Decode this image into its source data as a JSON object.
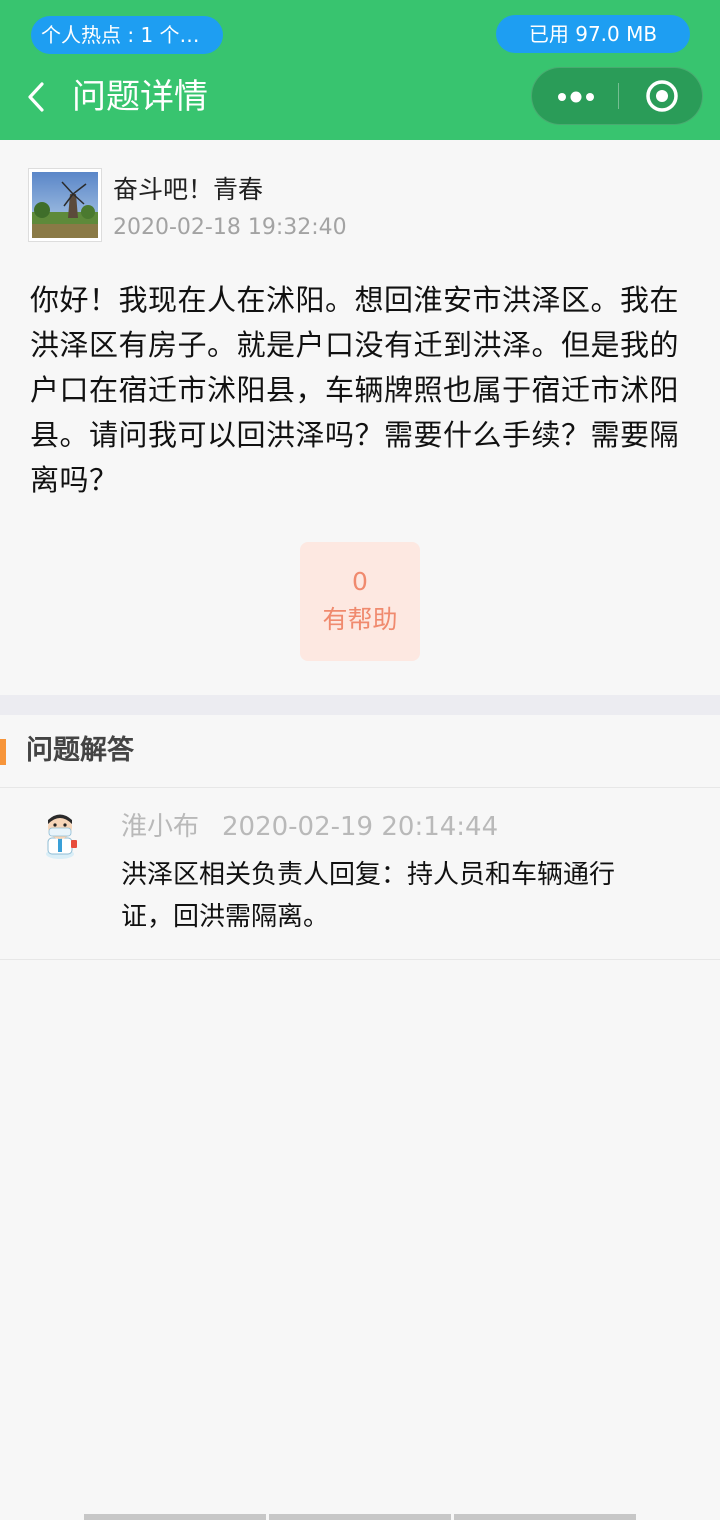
{
  "status": {
    "hotspot": "个人热点 : 1 个连...",
    "memory": "已用 97.0 MB"
  },
  "nav": {
    "back_icon": "chevron-left-icon",
    "title": "问题详情",
    "more_icon": "more-dots-icon",
    "close_icon": "target-circle-icon",
    "bar_color": "#38c46f"
  },
  "question": {
    "user_name": "奋斗吧！青春",
    "time": "2020-02-18 19:32:40",
    "text": "你好！我现在人在沭阳。想回淮安市洪泽区。我在洪泽区有房子。就是户口没有迁到洪泽。但是我的户口在宿迁市沭阳县，车辆牌照也属于宿迁市沭阳县。请问我可以回洪泽吗？需要什么手续？需要隔离吗？",
    "helpful_count": "0",
    "helpful_label": "有帮助"
  },
  "answers": {
    "title": "问题解答",
    "accent_color": "#f7953a",
    "items": [
      {
        "author": "淮小布",
        "time": "2020-02-19 20:14:44",
        "text": "洪泽区相关负责人回复：持人员和车辆通行证，回洪需隔离。"
      }
    ]
  }
}
